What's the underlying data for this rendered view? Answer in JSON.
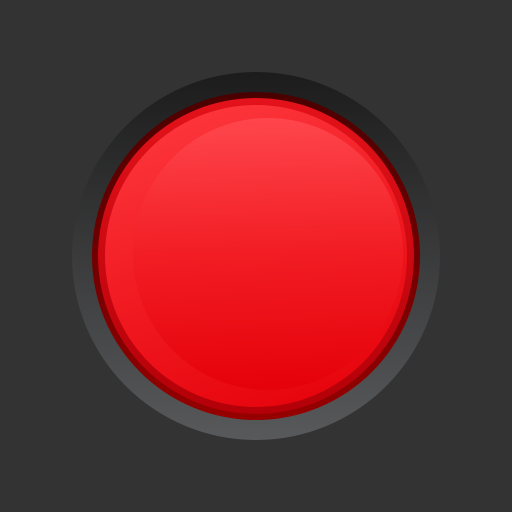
{
  "colors": {
    "background": "#333333",
    "bezel_top": "#1c1c1c",
    "bezel_bottom": "#58595b",
    "rim_top": "#4a0000",
    "rim_bottom": "#960000",
    "ring_top": "#e4121a",
    "ring_bottom": "#b30008",
    "cap_edge_light": "#ff3c42",
    "cap_top": "#ff4a50",
    "cap_mid": "#f21d24",
    "cap_bottom": "#e50008"
  },
  "button": {
    "icon": "red-push-button-icon"
  }
}
